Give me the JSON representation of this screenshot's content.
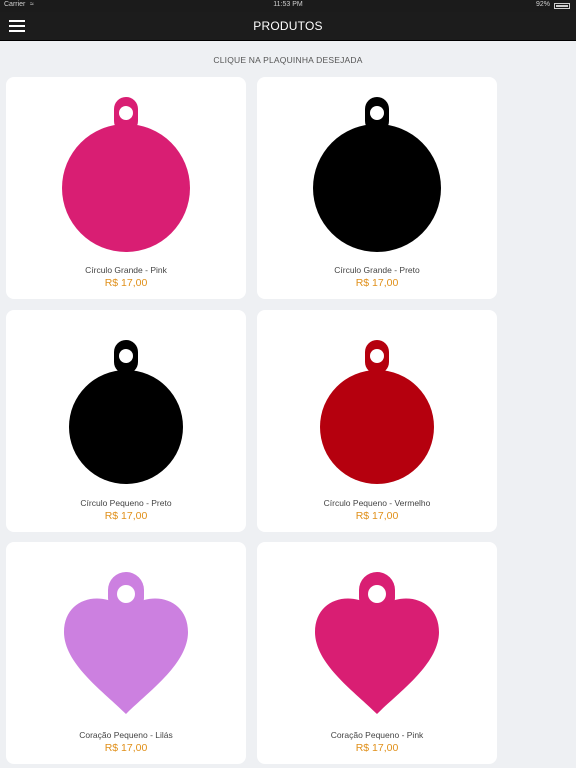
{
  "status_bar": {
    "carrier": "Carrier",
    "time": "11:53 PM",
    "battery": "92%"
  },
  "nav": {
    "title": "PRODUTOS"
  },
  "subtitle": "CLIQUE NA PLAQUINHA DESEJADA",
  "products": [
    {
      "name": "Círculo Grande - Pink",
      "price": "R$ 17,00",
      "shape": "circle-large",
      "color": "#d91e73"
    },
    {
      "name": "Círculo Grande - Preto",
      "price": "R$ 17,00",
      "shape": "circle-large",
      "color": "#000000"
    },
    {
      "name": "Círculo Pequeno - Preto",
      "price": "R$ 17,00",
      "shape": "circle-small",
      "color": "#000000"
    },
    {
      "name": "Círculo Pequeno - Vermelho",
      "price": "R$ 17,00",
      "shape": "circle-small",
      "color": "#b5000e"
    },
    {
      "name": "Coração Pequeno - Lilás",
      "price": "R$ 17,00",
      "shape": "heart",
      "color": "#cc80e0"
    },
    {
      "name": "Coração Pequeno - Pink",
      "price": "R$ 17,00",
      "shape": "heart",
      "color": "#d91e73"
    }
  ]
}
